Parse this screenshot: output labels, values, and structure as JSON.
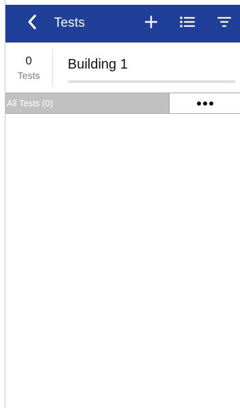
{
  "header": {
    "title": "Tests",
    "icons": {
      "back": "chevron-left-icon",
      "add": "plus-icon",
      "list": "list-icon",
      "filter": "filter-icon"
    }
  },
  "summary": {
    "test_count": "0",
    "test_count_label": "Tests",
    "building_name": "Building 1",
    "progress_fraction": 0
  },
  "filter_bar": {
    "all_tests_label": "All Tests (0)",
    "more_icon": "more-horizontal-icon"
  },
  "colors": {
    "header_background": "#1f3f98",
    "header_text": "#ffffff",
    "segment_background": "#c1c1c1"
  }
}
